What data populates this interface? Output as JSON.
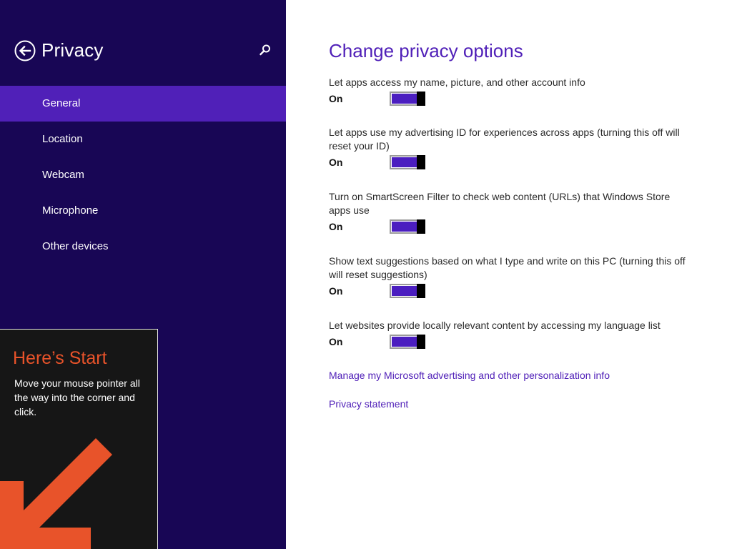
{
  "sidebar": {
    "title": "Privacy",
    "back_icon": "back-arrow-circle-icon",
    "search_icon": "search-icon",
    "items": [
      {
        "label": "General",
        "selected": true
      },
      {
        "label": "Location",
        "selected": false
      },
      {
        "label": "Webcam",
        "selected": false
      },
      {
        "label": "Microphone",
        "selected": false
      },
      {
        "label": "Other devices",
        "selected": false
      }
    ]
  },
  "start_tip": {
    "title": "Here’s Start",
    "body": "Move your mouse pointer all the way into the corner and click.",
    "arrow_icon": "corner-arrow-icon"
  },
  "main": {
    "title": "Change privacy options",
    "settings": [
      {
        "label": "Let apps access my name, picture, and other account info",
        "state": "On",
        "enabled": true
      },
      {
        "label": "Let apps use my advertising ID for experiences across apps (turning this off will reset your ID)",
        "state": "On",
        "enabled": true
      },
      {
        "label": "Turn on SmartScreen Filter to check web content (URLs) that Windows Store apps use",
        "state": "On",
        "enabled": true
      },
      {
        "label": "Show text suggestions based on what I type and write on this PC (turning this off will reset suggestions)",
        "state": "On",
        "enabled": true
      },
      {
        "label": "Let websites provide locally relevant content by accessing my language list",
        "state": "On",
        "enabled": true
      }
    ],
    "links": {
      "manage_advertising": "Manage my Microsoft advertising and other personalization info",
      "privacy_statement": "Privacy statement"
    }
  },
  "colors": {
    "sidebar_bg": "#180655",
    "selected_item": "#5020b8",
    "accent": "#5020b8",
    "toggle_on": "#4b1ec0",
    "tip_bg": "#161616",
    "tip_accent": "#e8532a"
  }
}
